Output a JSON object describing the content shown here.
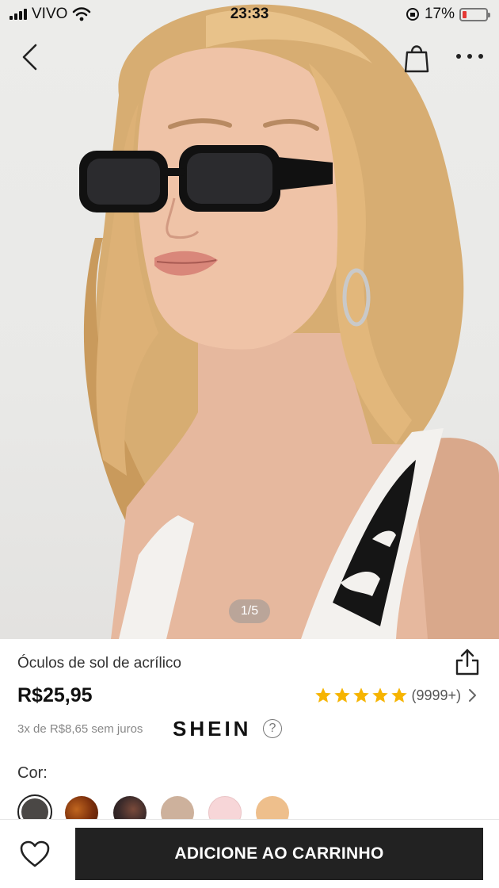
{
  "status_bar": {
    "carrier": "VIVO",
    "time": "23:33",
    "battery": "17%",
    "battery_level": 0.17
  },
  "nav": {
    "back_icon": "chevron-left-icon",
    "bag_icon": "shopping-bag-icon",
    "more_icon": "more-dots-icon"
  },
  "gallery": {
    "pager": "1/5",
    "current": 1,
    "total": 5
  },
  "product": {
    "title": "Óculos de sol de acrílico",
    "price": "R$25,95",
    "rating_stars": 5,
    "rating_count": "(9999+)",
    "installments": "3x de R$8,65 sem juros",
    "brand": "SHEIN",
    "help_symbol": "?",
    "color_label": "Cor:",
    "colors": [
      "#4a4745",
      "#8a3a12",
      "#3a2a2a",
      "#cdb19c",
      "#f7d6d8",
      "#eebf8c"
    ]
  },
  "actions": {
    "add_to_cart": "ADICIONE AO CARRINHO",
    "favorite_icon": "heart-icon",
    "share_icon": "share-icon"
  },
  "theme": {
    "accent_star": "#f6b400",
    "cta_background": "#222222"
  }
}
